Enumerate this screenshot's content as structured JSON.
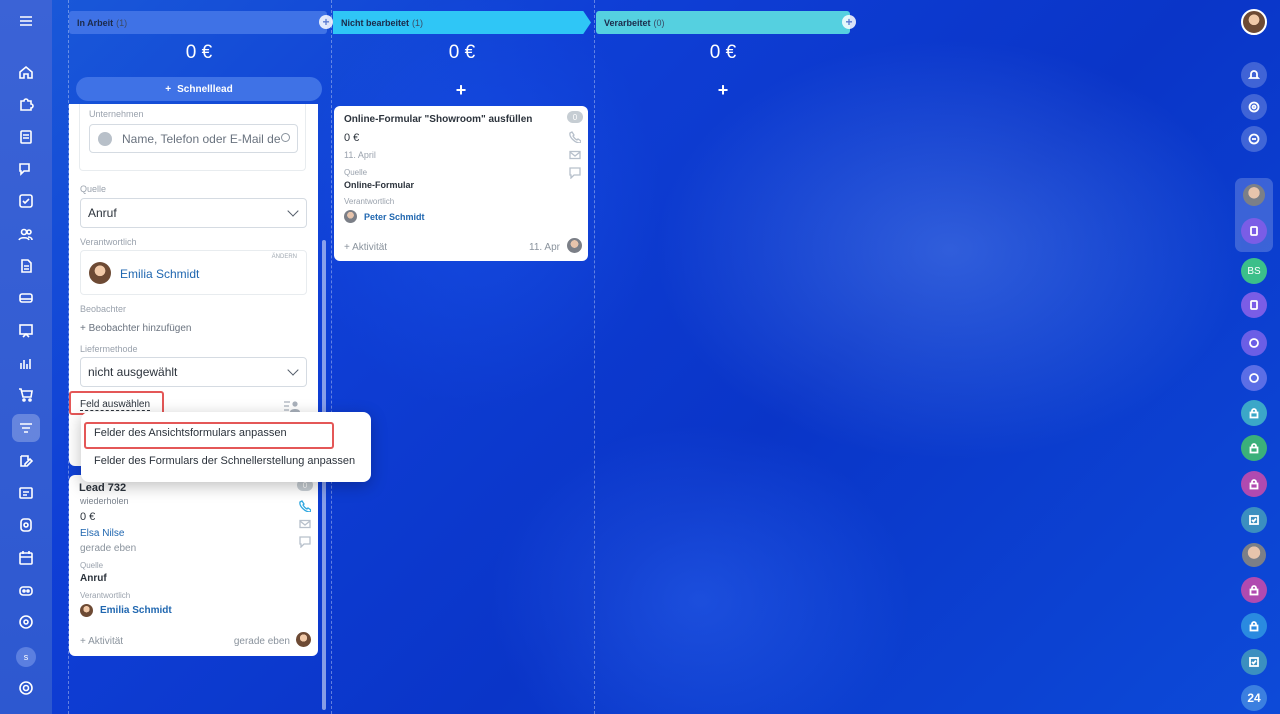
{
  "columns": [
    {
      "title": "In Arbeit",
      "count": "(1)",
      "sum": "0 €",
      "color": "#3f72e6"
    },
    {
      "title": "Nicht bearbeitet",
      "count": "(1)",
      "sum": "0 €",
      "color": "#2fc6f6"
    },
    {
      "title": "Verarbeitet",
      "count": "(0)",
      "sum": "0 €",
      "color": "#55d0e0"
    }
  ],
  "quick_lead_label": "Schnelllead",
  "add_symbol": "+",
  "edit_form": {
    "company_label": "Unternehmen",
    "company_placeholder": "Name, Telefon oder E-Mail de",
    "source_label": "Quelle",
    "source_value": "Anruf",
    "responsible_label": "Verantwortlich",
    "responsible_change": "ÄNDERN",
    "responsible_name": "Emilia Schmidt",
    "observers_label": "Beobachter",
    "observers_add": "+ Beobachter hinzufügen",
    "delivery_label": "Liefermethode",
    "delivery_value": "nicht ausgewählt",
    "select_field": "Feld auswählen"
  },
  "popup_menu": {
    "item1": "Felder des Ansichtsformulars anpassen",
    "item2": "Felder des Formulars der Schnellerstellung anpassen"
  },
  "lead_card": {
    "title": "Lead 732",
    "subtitle": "wiederholen",
    "amount": "0 €",
    "contact": "Elsa Nilse",
    "time": "gerade eben",
    "source_label": "Quelle",
    "source": "Anruf",
    "responsible_label": "Verantwortlich",
    "responsible": "Emilia Schmidt",
    "activity": "+ Aktivität",
    "footer_time": "gerade eben",
    "badge": "0"
  },
  "form_card": {
    "title": "Online-Formular \"Showroom\" ausfüllen",
    "amount": "0 €",
    "date": "11. April",
    "source_label": "Quelle",
    "source": "Online-Formular",
    "responsible_label": "Verantwortlich",
    "responsible": "Peter Schmidt",
    "activity": "+ Aktivität",
    "footer_date": "11. Apr",
    "badge": "0"
  },
  "left_avatar_letter": "s",
  "right_bar": {
    "bs_initials": "BS",
    "logo": "24"
  },
  "icons": {
    "menu": "hamburger-icon",
    "home": "home-icon",
    "puzzle": "puzzle-icon",
    "doc": "document-icon",
    "chat": "chat-icon",
    "tasks": "tasks-icon",
    "contacts": "contacts-icon",
    "file": "file-icon",
    "inbox": "inbox-icon",
    "board": "board-icon",
    "chart": "chart-icon",
    "cart": "cart-icon",
    "crm": "crm-filter-icon",
    "edit": "edit-icon",
    "sites": "sites-icon",
    "pin": "pin-icon",
    "calendar": "calendar-icon",
    "robot": "robot-icon",
    "target": "target-icon",
    "settings": "settings-icon"
  }
}
